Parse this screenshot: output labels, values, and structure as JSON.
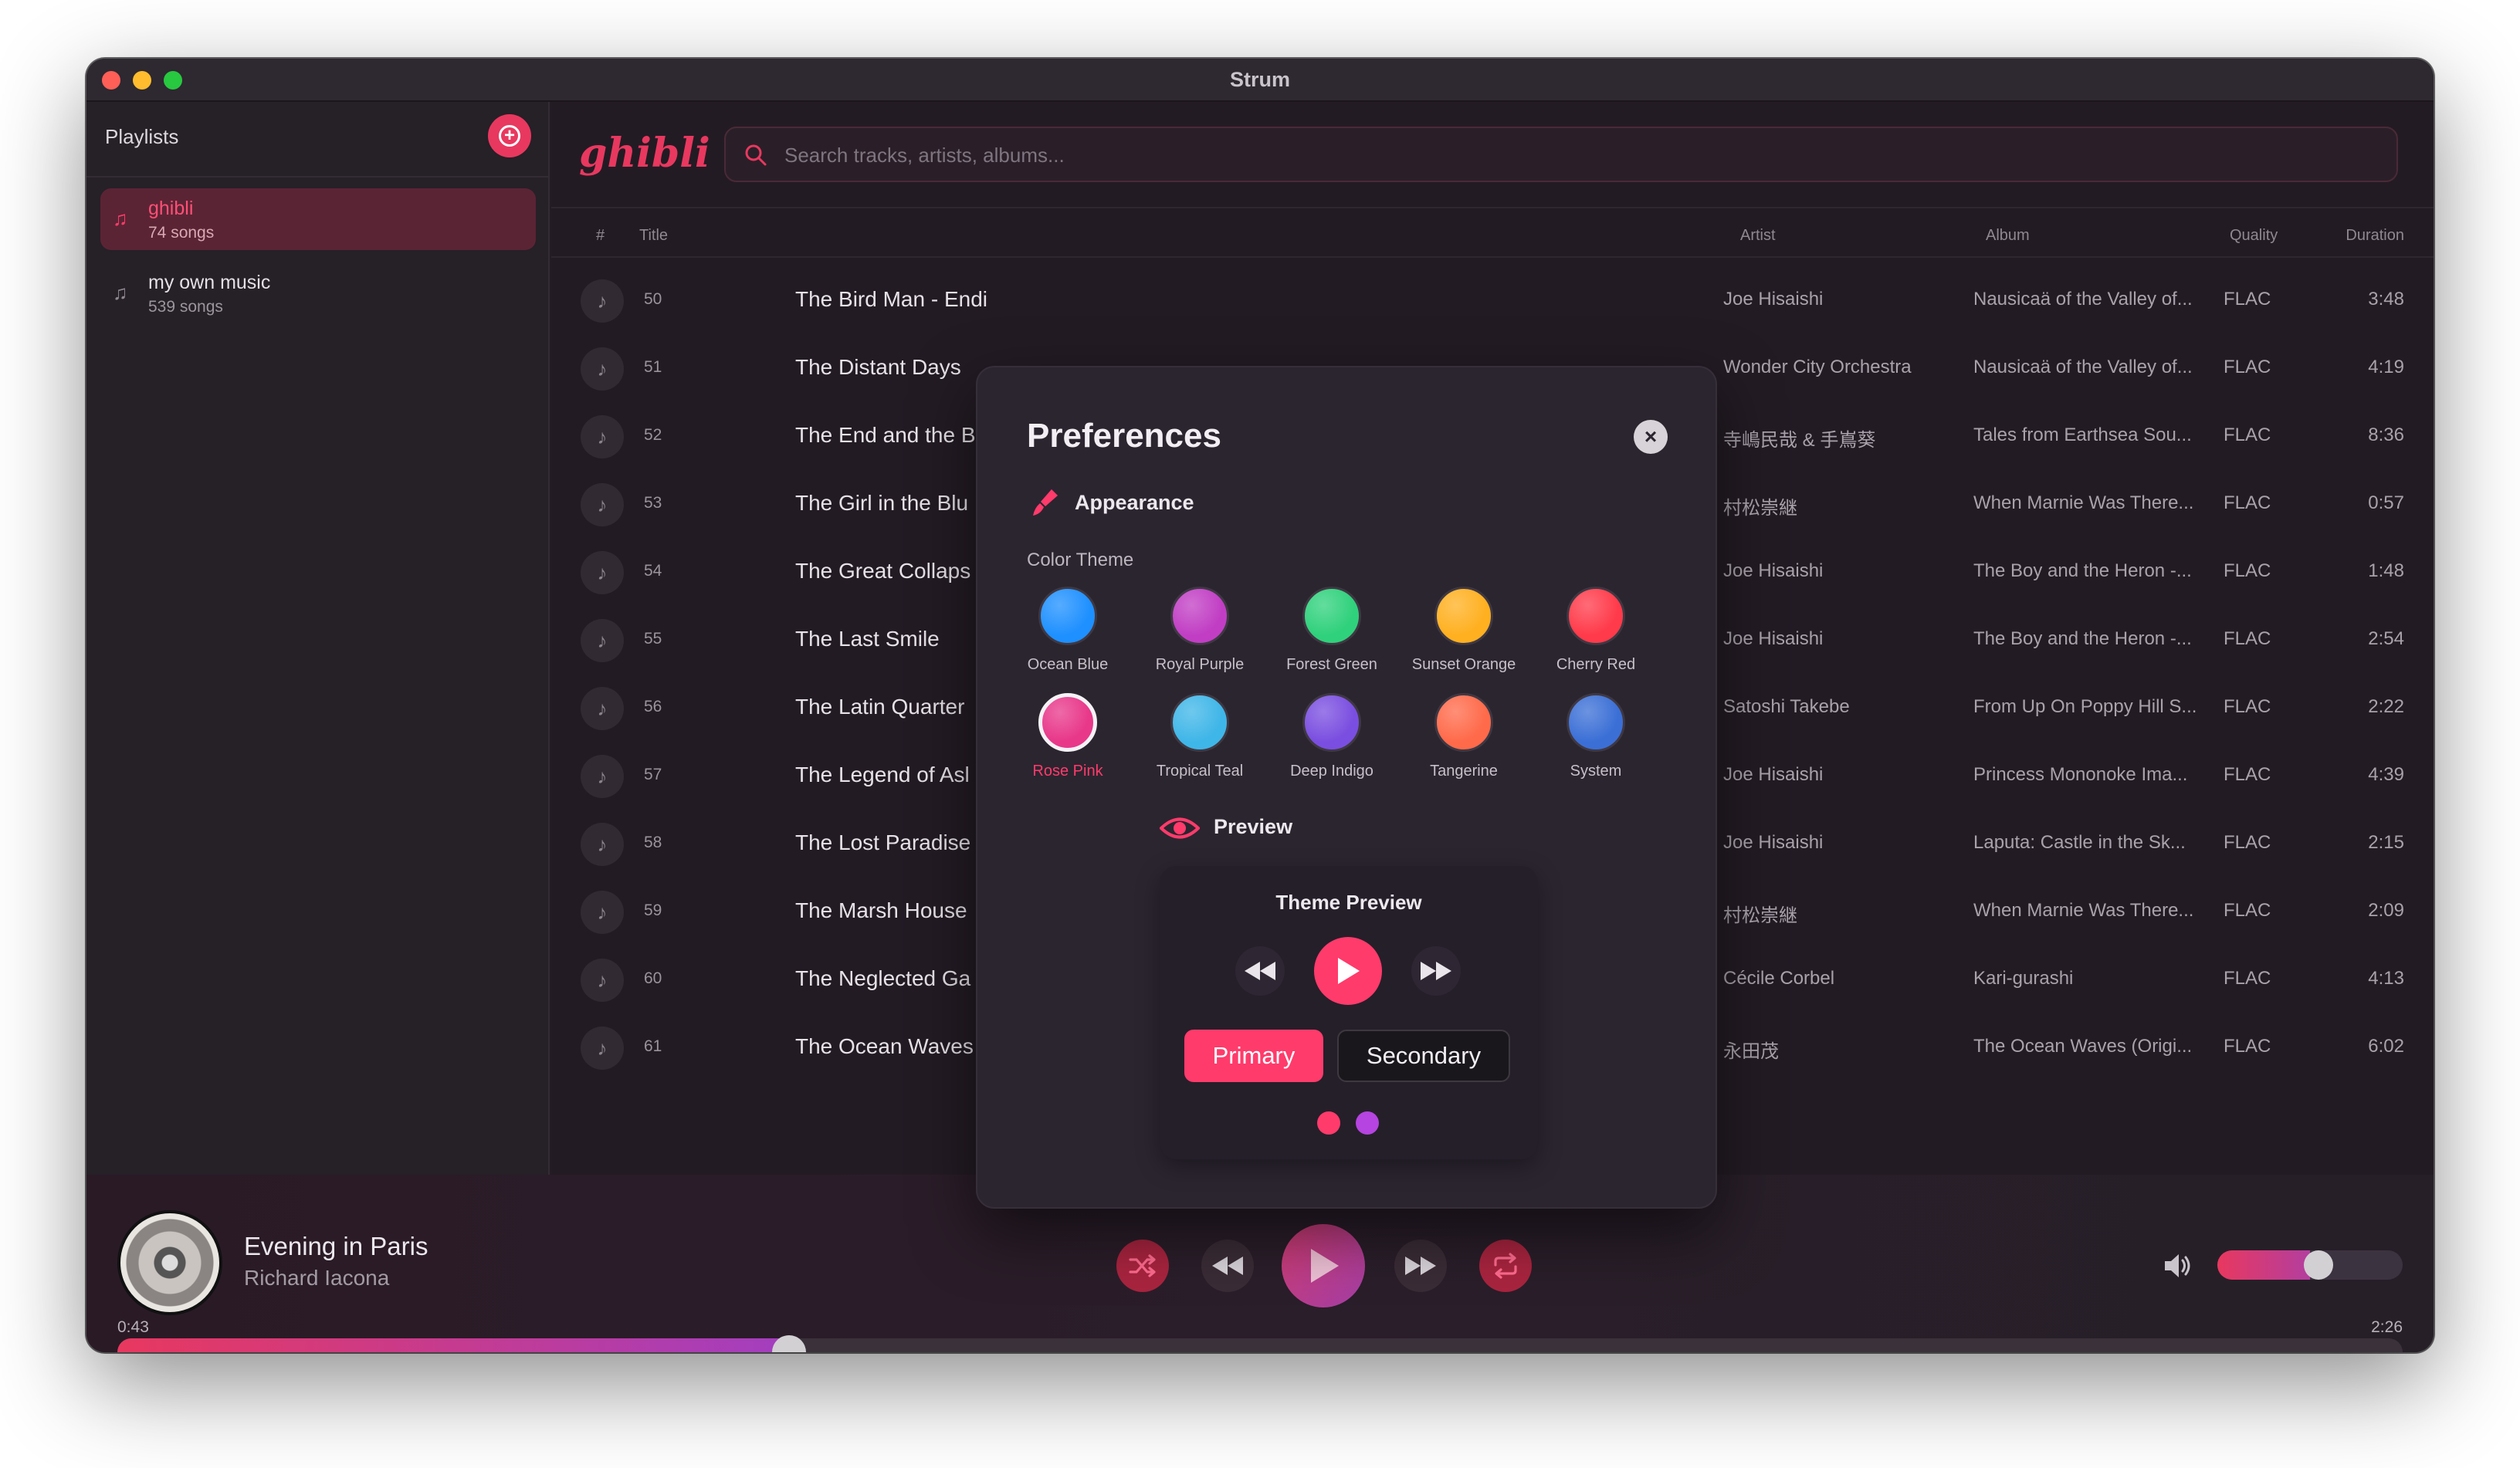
{
  "window": {
    "title": "Strum"
  },
  "sidebar": {
    "header": "Playlists",
    "playlists": [
      {
        "name": "ghibli",
        "count": "74 songs",
        "active": true
      },
      {
        "name": "my own music",
        "count": "539 songs",
        "active": false
      }
    ]
  },
  "main": {
    "logo": "ghibli",
    "search": {
      "placeholder": "Search tracks, artists, albums..."
    },
    "columns": {
      "num": "#",
      "title": "Title",
      "artist": "Artist",
      "album": "Album",
      "quality": "Quality",
      "duration": "Duration"
    },
    "tracks": [
      {
        "num": "50",
        "title": "The Bird Man - Endi",
        "artist": "Joe Hisaishi",
        "album": "Nausicaä of the Valley of...",
        "quality": "FLAC",
        "duration": "3:48"
      },
      {
        "num": "51",
        "title": "The Distant Days",
        "artist": "Wonder City Orchestra",
        "album": "Nausicaä of the Valley of...",
        "quality": "FLAC",
        "duration": "4:19"
      },
      {
        "num": "52",
        "title": "The End and the B",
        "artist": "寺嶋民哉 & 手嶌葵",
        "album": "Tales from Earthsea Sou...",
        "quality": "FLAC",
        "duration": "8:36"
      },
      {
        "num": "53",
        "title": "The Girl in the Blu",
        "artist": "村松崇継",
        "album": "When Marnie Was There...",
        "quality": "FLAC",
        "duration": "0:57"
      },
      {
        "num": "54",
        "title": "The Great Collaps",
        "artist": "Joe Hisaishi",
        "album": "The Boy and the Heron -...",
        "quality": "FLAC",
        "duration": "1:48"
      },
      {
        "num": "55",
        "title": "The Last Smile",
        "artist": "Joe Hisaishi",
        "album": "The Boy and the Heron -...",
        "quality": "FLAC",
        "duration": "2:54"
      },
      {
        "num": "56",
        "title": "The Latin Quarter",
        "artist": "Satoshi Takebe",
        "album": "From Up On Poppy Hill S...",
        "quality": "FLAC",
        "duration": "2:22"
      },
      {
        "num": "57",
        "title": "The Legend of Asl",
        "artist": "Joe Hisaishi",
        "album": "Princess Mononoke Ima...",
        "quality": "FLAC",
        "duration": "4:39"
      },
      {
        "num": "58",
        "title": "The Lost Paradise",
        "artist": "Joe Hisaishi",
        "album": "Laputa: Castle in the Sk...",
        "quality": "FLAC",
        "duration": "2:15"
      },
      {
        "num": "59",
        "title": "The Marsh House",
        "artist": "村松崇継",
        "album": "When Marnie Was There...",
        "quality": "FLAC",
        "duration": "2:09"
      },
      {
        "num": "60",
        "title": "The Neglected Ga",
        "artist": "Cécile Corbel",
        "album": "Kari-gurashi",
        "quality": "FLAC",
        "duration": "4:13"
      },
      {
        "num": "61",
        "title": "The Ocean Waves",
        "artist": "永田茂",
        "album": "The Ocean Waves (Origi...",
        "quality": "FLAC",
        "duration": "6:02"
      }
    ]
  },
  "player": {
    "title": "Evening in Paris",
    "artist": "Richard Iacona",
    "elapsed": "0:43",
    "total": "2:26",
    "progress_fraction": 0.294,
    "volume_fraction": 0.5
  },
  "preferences": {
    "title": "Preferences",
    "appearance_label": "Appearance",
    "color_theme_label": "Color Theme",
    "themes": [
      {
        "name": "Ocean Blue",
        "color": "#1e90ff"
      },
      {
        "name": "Royal Purple",
        "color": "#c13ec4"
      },
      {
        "name": "Forest Green",
        "color": "#2fd17c"
      },
      {
        "name": "Sunset Orange",
        "color": "#ffb020"
      },
      {
        "name": "Cherry Red",
        "color": "#ff3a4a"
      },
      {
        "name": "Rose Pink",
        "color": "#e8388a",
        "selected": true
      },
      {
        "name": "Tropical Teal",
        "color": "#3fb6e8"
      },
      {
        "name": "Deep Indigo",
        "color": "#7a4ee0"
      },
      {
        "name": "Tangerine",
        "color": "#ff6a4a"
      },
      {
        "name": "System",
        "color": "#3b6fd6"
      }
    ],
    "preview_label": "Preview",
    "theme_preview": {
      "title": "Theme Preview",
      "primary_label": "Primary",
      "secondary_label": "Secondary",
      "primary_color": "#ff3b6b",
      "secondary_color": "#b544e0"
    }
  },
  "colors": {
    "accent": "#e8385f",
    "background": "#231b24"
  }
}
